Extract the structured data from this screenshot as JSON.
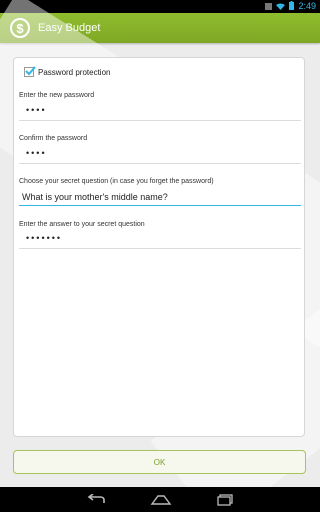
{
  "status_bar": {
    "time": "2:49",
    "icons": [
      "wifi-icon",
      "battery-icon",
      "notification-icon"
    ]
  },
  "action_bar": {
    "app_icon": "dollar-coin-icon",
    "title": "Easy Budget"
  },
  "form": {
    "password_protection": {
      "label": "Password protection",
      "checked": true
    },
    "new_password": {
      "label": "Enter the new password",
      "value": "••••"
    },
    "confirm_password": {
      "label": "Confirm the password",
      "value": "••••"
    },
    "secret_question": {
      "label": "Choose your secret question (in case you forget the password)",
      "value": "What is your mother's middle name?"
    },
    "secret_answer": {
      "label": "Enter the answer to your secret question",
      "value": "•••••••"
    }
  },
  "ok_button": {
    "label": "OK"
  },
  "nav_bar": {
    "icons": [
      "back-icon",
      "home-icon",
      "recent-apps-icon"
    ]
  },
  "colors": {
    "accent": "#8ab52a",
    "focus": "#33b5e5"
  }
}
